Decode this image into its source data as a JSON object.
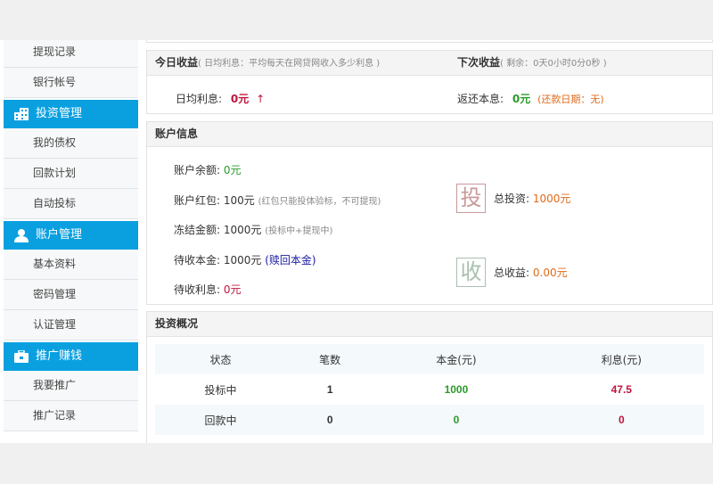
{
  "sidebar": {
    "items": [
      {
        "label": "",
        "type": "item"
      },
      {
        "label": "提现记录",
        "type": "item"
      },
      {
        "label": "银行帐号",
        "type": "item"
      },
      {
        "label": "投资管理",
        "type": "head",
        "icon": "building-icon"
      },
      {
        "label": "我的债权",
        "type": "item"
      },
      {
        "label": "回款计划",
        "type": "item"
      },
      {
        "label": "自动投标",
        "type": "item"
      },
      {
        "label": "账户管理",
        "type": "head",
        "icon": "user-icon"
      },
      {
        "label": "基本资料",
        "type": "item"
      },
      {
        "label": "密码管理",
        "type": "item"
      },
      {
        "label": "认证管理",
        "type": "item"
      },
      {
        "label": "推广赚钱",
        "type": "head",
        "icon": "briefcase-icon"
      },
      {
        "label": "我要推广",
        "type": "item"
      },
      {
        "label": "推广记录",
        "type": "item"
      }
    ]
  },
  "today": {
    "title": "今日收益",
    "note": "( 日均利息：平均每天在网贷网收入多少利息 )",
    "daily_label": "日均利息:",
    "daily_value": "0元",
    "arrow": "↑"
  },
  "next": {
    "title": "下次收益",
    "note": "( 剩余：0天0小时0分0秒 )",
    "return_label": "返还本息:",
    "return_value": "0元",
    "return_date": "(还款日期：无)"
  },
  "account": {
    "title": "账户信息",
    "balance_label": "账户余额:",
    "balance": "0元",
    "bonus_label": "账户红包:",
    "bonus": "100元",
    "bonus_note": "(红包只能投体验标，不可提现)",
    "frozen_label": "冻结金额:",
    "frozen": "1000元",
    "frozen_note": "(投标中+提现中)",
    "principal_label": "待收本金:",
    "principal": "1000元",
    "redeem_link": "(赎回本金)",
    "interest_label": "待收利息:",
    "interest": "0元",
    "invest_stamp": "投",
    "total_invest_label": "总投资:",
    "total_invest": "1000元",
    "income_stamp": "收",
    "total_income_label": "总收益:",
    "total_income": "0.00元"
  },
  "overview": {
    "title": "投资概况",
    "headers": [
      "状态",
      "笔数",
      "本金(元)",
      "利息(元)"
    ],
    "rows": [
      [
        "投标中",
        "1",
        "1000",
        "47.5"
      ],
      [
        "回款中",
        "0",
        "0",
        "0"
      ]
    ]
  },
  "colors": {
    "accent": "#0aa0e0",
    "red": "#c0143c",
    "green": "#2a9a2a",
    "orange": "#e06a1a"
  }
}
